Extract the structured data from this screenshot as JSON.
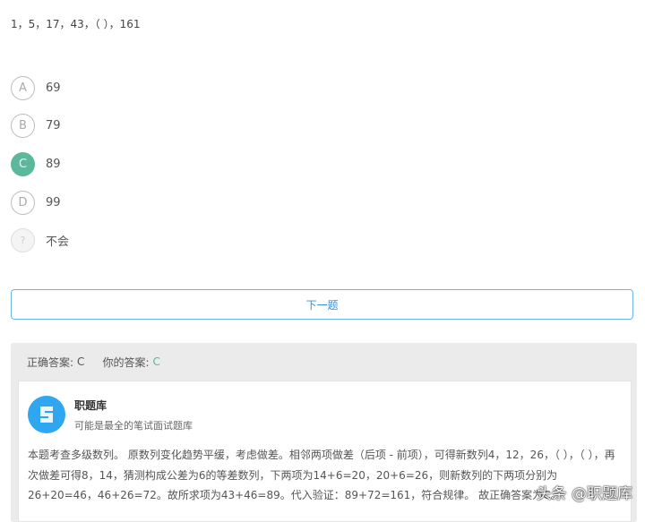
{
  "question": "1，5，17，43，（ ），161",
  "options": [
    {
      "letter": "A",
      "text": "69"
    },
    {
      "letter": "B",
      "text": "79"
    },
    {
      "letter": "C",
      "text": "89"
    },
    {
      "letter": "D",
      "text": "99"
    },
    {
      "letter": "?",
      "text": "不会"
    }
  ],
  "next_label": "下一题",
  "answer": {
    "correct_label": "正确答案:",
    "correct": "C",
    "yours_label": "你的答案:",
    "yours": "C"
  },
  "source": {
    "name": "职题库",
    "tagline": "可能是最全的笔试面试题库"
  },
  "explanation": "本题考查多级数列。 原数列变化趋势平缓，考虑做差。相邻两项做差（后项 - 前项），可得新数列4，12，26，（ ），（ ），再次做差可得8，14，猜测构成公差为6的等差数列，下两项为14+6=20，20+6=26，则新数列的下两项分别为26+20=46，46+26=72。故所求项为43+46=89。代入验证：89+72=161，符合规律。 故正确答案为C。",
  "watermark": "头条 @职题库",
  "colors": {
    "selected": "#5bb89a",
    "accent": "#3a8fd6",
    "logo": "#2ea6f0"
  }
}
